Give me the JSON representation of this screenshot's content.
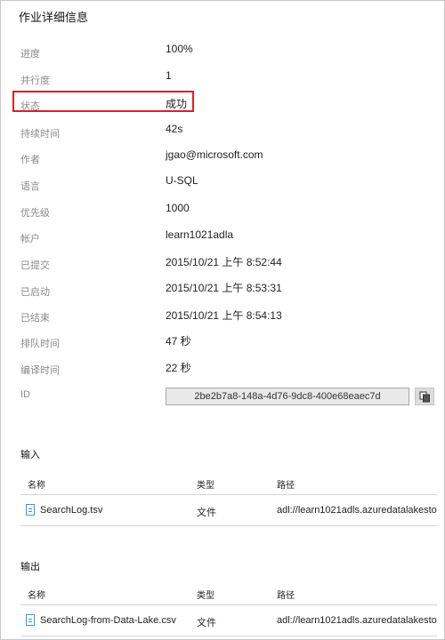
{
  "panel": {
    "title": "作业详细信息"
  },
  "properties": [
    {
      "label": "进度",
      "value": "100%"
    },
    {
      "label": "并行度",
      "value": "1"
    },
    {
      "label": "状态",
      "value": "成功"
    },
    {
      "label": "持续时间",
      "value": "42s"
    },
    {
      "label": "作者",
      "value": "jgao@microsoft.com"
    },
    {
      "label": "语言",
      "value": "U-SQL"
    },
    {
      "label": "优先级",
      "value": "1000"
    },
    {
      "label": "帐户",
      "value": "learn1021adla"
    },
    {
      "label": "已提交",
      "value": "2015/10/21 上午 8:52:44"
    },
    {
      "label": "已启动",
      "value": "2015/10/21 上午 8:53:31"
    },
    {
      "label": "已结束",
      "value": "2015/10/21 上午 8:54:13"
    },
    {
      "label": "排队时间",
      "value": "47 秒"
    },
    {
      "label": "编译时间",
      "value": "22 秒"
    }
  ],
  "id": {
    "label": "ID",
    "value": "2be2b7a8-148a-4d76-9dc8-400e68eaec7d"
  },
  "icons": {
    "copy": "copy-icon",
    "file": "file-icon"
  },
  "highlight_color": "#e01e1e",
  "input": {
    "title": "输入",
    "headers": {
      "name": "名称",
      "type": "类型",
      "path": "路径"
    },
    "rows": [
      {
        "name": "SearchLog.tsv",
        "type": "文件",
        "path": "adl://learn1021adls.azuredatalakesto..."
      }
    ]
  },
  "output": {
    "title": "输出",
    "headers": {
      "name": "名称",
      "type": "类型",
      "path": "路径"
    },
    "rows": [
      {
        "name": "SearchLog-from-Data-Lake.csv",
        "type": "文件",
        "path": "adl://learn1021adls.azuredatalakesto..."
      }
    ]
  }
}
